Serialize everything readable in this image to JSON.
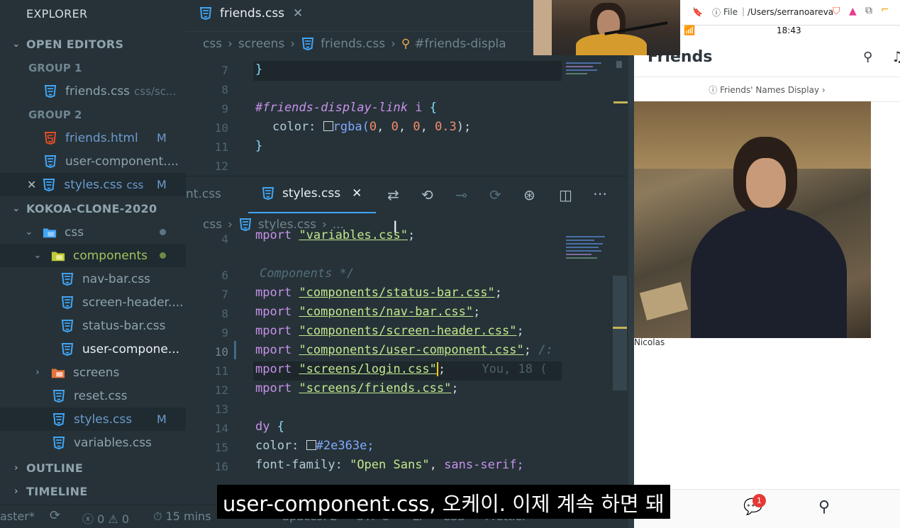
{
  "sidebar": {
    "title": "EXPLORER",
    "open_editors_label": "OPEN EDITORS",
    "group1_label": "GROUP 1",
    "group1_file": "friends.css",
    "group1_file_path": "css/sc...",
    "group2_label": "GROUP 2",
    "group2_files": [
      {
        "name": "friends.html",
        "badge": "M"
      },
      {
        "name": "user-component....",
        "badge": ""
      },
      {
        "name": "styles.css",
        "desc": "css",
        "badge": "M"
      }
    ],
    "project_label": "KOKOA-CLONE-2020",
    "tree": {
      "css": "css",
      "components": "components",
      "component_files": [
        "nav-bar.css",
        "screen-header....",
        "status-bar.css",
        "user-compone..."
      ],
      "screens": "screens",
      "reset": "reset.css",
      "styles": "styles.css",
      "styles_badge": "M",
      "variables": "variables.css"
    },
    "outline_label": "OUTLINE",
    "timeline_label": "TIMELINE"
  },
  "editor_top": {
    "tab_label": "friends.css",
    "breadcrumb": [
      "css",
      "screens",
      "friends.css",
      "#friends-displa"
    ],
    "line_numbers": [
      "7",
      "8",
      "9",
      "10",
      "11",
      "12"
    ],
    "code": {
      "close_brace": "}",
      "selector": "#friends-display-link",
      "selector_tag": "i",
      "open_brace": "{",
      "prop": "color:",
      "fn": "rgba(",
      "values": [
        "0",
        "0",
        "0",
        "0.3"
      ],
      "fn_end": ");",
      "end_brace": "}"
    }
  },
  "editor_bottom": {
    "prev_tab_fragment": "nt.css",
    "tab_label": "styles.css",
    "breadcrumb": [
      "css",
      "styles.css",
      "..."
    ],
    "line_numbers": [
      "4",
      "6",
      "7",
      "8",
      "9",
      "10",
      "11",
      "12",
      "13",
      "14",
      "15",
      "16"
    ],
    "lines": {
      "l4": "\"variables.css\"",
      "l6": "Components */",
      "imports": [
        "\"components/status-bar.css\"",
        "\"components/nav-bar.css\"",
        "\"components/screen-header.css\"",
        "\"components/user-component.css\"",
        "\"screens/login.css\"",
        "\"screens/friends.css\""
      ],
      "import_kw": "mport",
      "import_kw_first": "mport",
      "blame": "You, 18 (",
      "comment_fragment": "/:",
      "body_sel": "dy",
      "body_brace": "{",
      "color_prop": "color:",
      "color_val": "#2e363e;",
      "font_prop": "font-family:",
      "font_val1": "\"Open Sans\"",
      "font_val2": "sans-serif;"
    }
  },
  "statusbar": {
    "branch": "aster*",
    "errors": "0",
    "warnings": "0",
    "time_ago": "15 mins",
    "spaces": "Spaces: 2",
    "encoding": "UTF-8",
    "eol": "LF",
    "lang": "CSS",
    "formatter": "Prettier"
  },
  "browser": {
    "address_prefix": "File",
    "address": "/Users/serranoareval...",
    "time": "18:43",
    "page_title": "Friends",
    "link": "Friends' Names Display",
    "caption": "Nicolas",
    "notification_count": "1"
  },
  "subtitle": "user-component.css, 오케이. 이제 계속 하면 돼",
  "colors": {
    "editor_bg": "#263238",
    "string": "#c3e88d",
    "keyword": "#c792ea",
    "function": "#82aaff",
    "number": "#f78c6c",
    "css_icon": "#42a5f5",
    "html_icon": "#e44d26",
    "notification": "#e53935"
  }
}
